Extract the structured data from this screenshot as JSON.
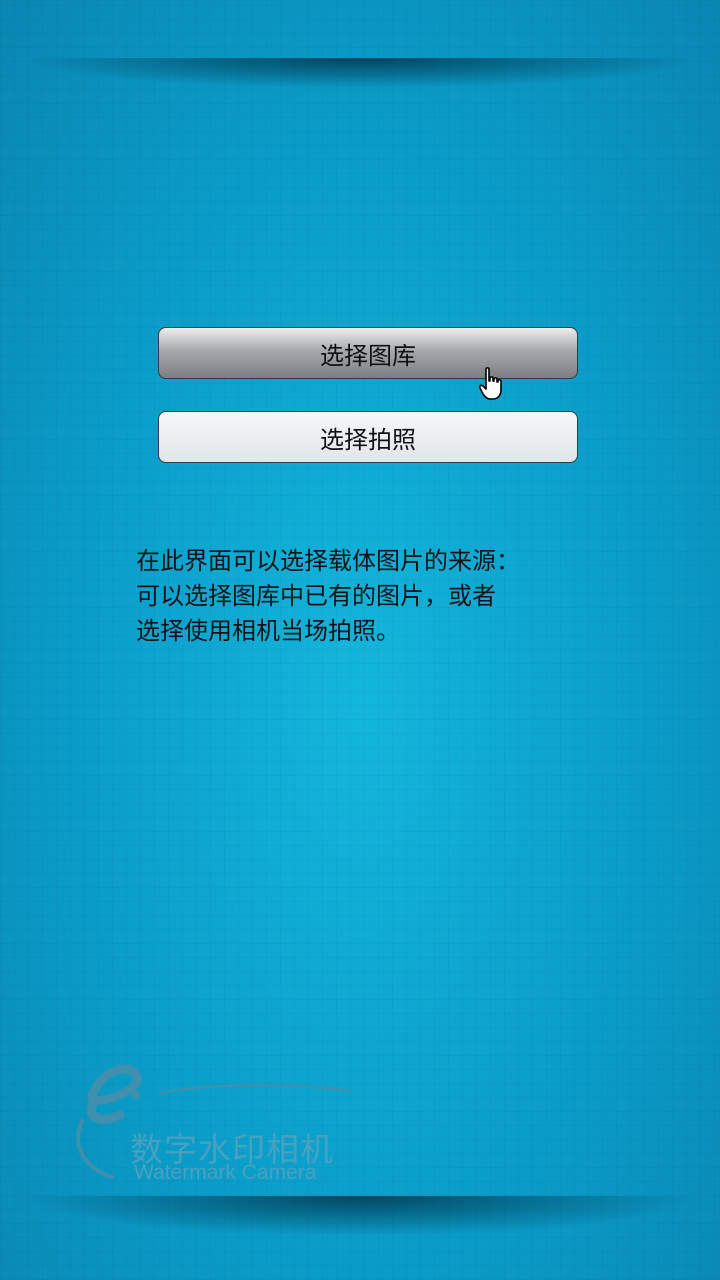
{
  "buttons": {
    "gallery_label": "选择图库",
    "camera_label": "选择拍照"
  },
  "description": {
    "line1": "在此界面可以选择载体图片的来源：",
    "line2": "可以选择图库中已有的图片，或者",
    "line3": "选择使用相机当场拍照。"
  },
  "logo": {
    "name_cn": "数字水印相机",
    "name_en": "Watermark Camera",
    "mark": "e"
  },
  "colors": {
    "background": "#0a9dc9",
    "logo": "#4aa0c0"
  },
  "icons": {
    "cursor": "hand-pointer-icon"
  }
}
